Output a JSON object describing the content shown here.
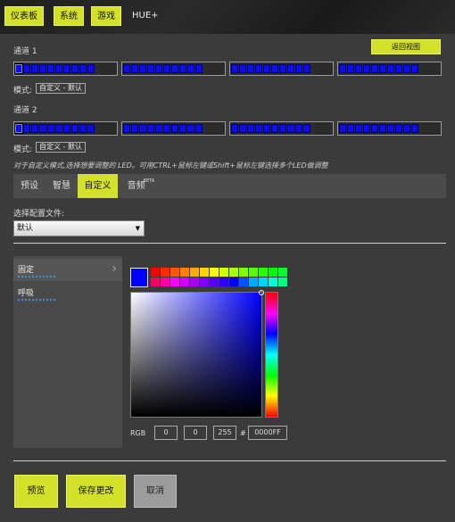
{
  "nav": {
    "tabs": [
      "仪表板",
      "系统",
      "游戏"
    ],
    "current": "HUE+"
  },
  "back_button": "返回视图",
  "channels": [
    {
      "label": "通道 1",
      "mode_label": "模式:",
      "mode_value": "自定义 - 默认"
    },
    {
      "label": "通道 2",
      "mode_label": "模式:",
      "mode_value": "自定义 - 默认"
    }
  ],
  "hint": "对于自定义模式,选择想要调整的 LED。可用CTRL+鼠标左键或Shift+鼠标左键选择多个LED做调整",
  "subtabs": [
    {
      "label": "预设",
      "beta": ""
    },
    {
      "label": "智慧",
      "beta": ""
    },
    {
      "label": "自定义",
      "beta": ""
    },
    {
      "label": "音频",
      "beta": "BETA"
    }
  ],
  "profile": {
    "label": "选择配置文件:",
    "selected": "默认"
  },
  "effects": [
    "固定",
    "呼吸"
  ],
  "color": {
    "current": "#0000FF",
    "palette": [
      "#ff0000",
      "#ff2a00",
      "#ff5500",
      "#ff8000",
      "#ffaa00",
      "#ffd400",
      "#ffff00",
      "#d4ff00",
      "#aaff00",
      "#80ff00",
      "#55ff00",
      "#2aff00",
      "#00ff00",
      "#00ff2a",
      "#ff0066",
      "#ff00aa",
      "#ff00ff",
      "#d400ff",
      "#aa00ff",
      "#8000ff",
      "#5500ff",
      "#2a00ff",
      "#0000ff",
      "#0055ff",
      "#00aaff",
      "#00d4ff",
      "#00ffd4",
      "#00ff80"
    ]
  },
  "rgb": {
    "label": "RGB",
    "r": "0",
    "g": "0",
    "b": "255",
    "hash": "#",
    "hex": "0000FF"
  },
  "footer": {
    "preview": "预览",
    "save": "保存更改",
    "cancel": "取消"
  }
}
